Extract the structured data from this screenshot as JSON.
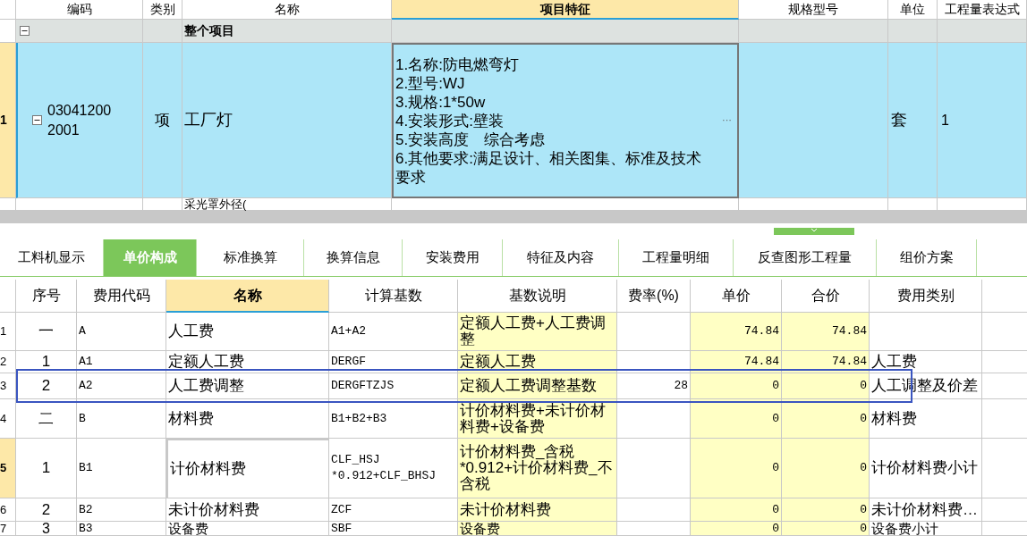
{
  "top_table": {
    "columns": [
      {
        "label": "编码",
        "highlighted": false
      },
      {
        "label": "类别",
        "highlighted": false
      },
      {
        "label": "名称",
        "highlighted": false
      },
      {
        "label": "项目特征",
        "highlighted": true
      },
      {
        "label": "规格型号",
        "highlighted": false
      },
      {
        "label": "单位",
        "highlighted": false
      },
      {
        "label": "工程量表达式",
        "highlighted": false
      }
    ],
    "group_row": {
      "label": "整个项目",
      "expanded": true
    },
    "rows": [
      {
        "row_number": "1",
        "selected": true,
        "expanded": true,
        "code": "030412002001",
        "type": "项",
        "name": "工厂灯",
        "features": [
          "1.名称:防电燃弯灯",
          "2.型号:WJ",
          "3.规格:1*50w",
          "4.安装形式:壁装",
          "5.安装高度　综合考虑",
          "6.其他要求:满足设计、相关图集、标准及技术要求"
        ],
        "more_button": "···",
        "unit": "套",
        "quantity": "1"
      }
    ],
    "partial_row": {
      "name": "采光罩外径("
    }
  },
  "tabs": [
    {
      "label": "工料机显示",
      "selected": false
    },
    {
      "label": "单价构成",
      "selected": true
    },
    {
      "label": "标准换算",
      "selected": false
    },
    {
      "label": "换算信息",
      "selected": false
    },
    {
      "label": "安装费用",
      "selected": false
    },
    {
      "label": "特征及内容",
      "selected": false
    },
    {
      "label": "工程量明细",
      "selected": false
    },
    {
      "label": "反查图形工程量",
      "selected": false
    },
    {
      "label": "组价方案",
      "selected": false
    }
  ],
  "detail_table": {
    "columns": [
      {
        "label": "序号",
        "highlighted": false
      },
      {
        "label": "费用代码",
        "highlighted": false
      },
      {
        "label": "名称",
        "highlighted": true
      },
      {
        "label": "计算基数",
        "highlighted": false
      },
      {
        "label": "基数说明",
        "highlighted": false
      },
      {
        "label": "费率(%)",
        "highlighted": false
      },
      {
        "label": "单价",
        "highlighted": false
      },
      {
        "label": "合价",
        "highlighted": false
      },
      {
        "label": "费用类别",
        "highlighted": false
      }
    ],
    "rows": [
      {
        "row_number": "1",
        "selected": false,
        "outlined": false,
        "seq": "一",
        "code": "A",
        "name": "人工费",
        "base": "A1+A2",
        "base_desc": "定额人工费+人工费调整",
        "price": "74.84",
        "total": "74.84"
      },
      {
        "row_number": "2",
        "selected": false,
        "outlined": false,
        "seq": "1",
        "code": "A1",
        "name": "定额人工费",
        "base": "DERGF",
        "base_desc": "定额人工费",
        "price": "74.84",
        "total": "74.84",
        "category": "人工费"
      },
      {
        "row_number": "3",
        "selected": false,
        "outlined": true,
        "seq": "2",
        "code": "A2",
        "name": "人工费调整",
        "base": "DERGFTZJS",
        "base_desc": "定额人工费调整基数",
        "rate": "28",
        "price": "0",
        "total": "0",
        "category": "人工调整及价差"
      },
      {
        "row_number": "4",
        "selected": false,
        "outlined": false,
        "seq": "二",
        "code": "B",
        "name": "材料费",
        "base": "B1+B2+B3",
        "base_desc": "计价材料费+未计价材料费+设备费",
        "price": "0",
        "total": "0",
        "category": "材料费"
      },
      {
        "row_number": "5",
        "selected": true,
        "outlined": false,
        "seq": "1",
        "code": "B1",
        "name": "计价材料费",
        "base": "CLF_HSJ *0.912+CLF_BHSJ",
        "base_desc": "计价材料费_含税 *0.912+计价材料费_不含税",
        "price": "0",
        "total": "0",
        "category": "计价材料费小计"
      },
      {
        "row_number": "6",
        "selected": false,
        "outlined": false,
        "seq": "2",
        "code": "B2",
        "name": "未计价材料费",
        "base": "ZCF",
        "base_desc": "未计价材料费",
        "price": "0",
        "total": "0",
        "category": "未计价材料费…"
      },
      {
        "row_number": "7",
        "selected": false,
        "outlined": false,
        "seq": "3",
        "code": "B3",
        "name": "设备费",
        "base": "SBF",
        "base_desc": "设备费",
        "price": "0",
        "total": "0",
        "category": "设备费小计"
      }
    ]
  }
}
